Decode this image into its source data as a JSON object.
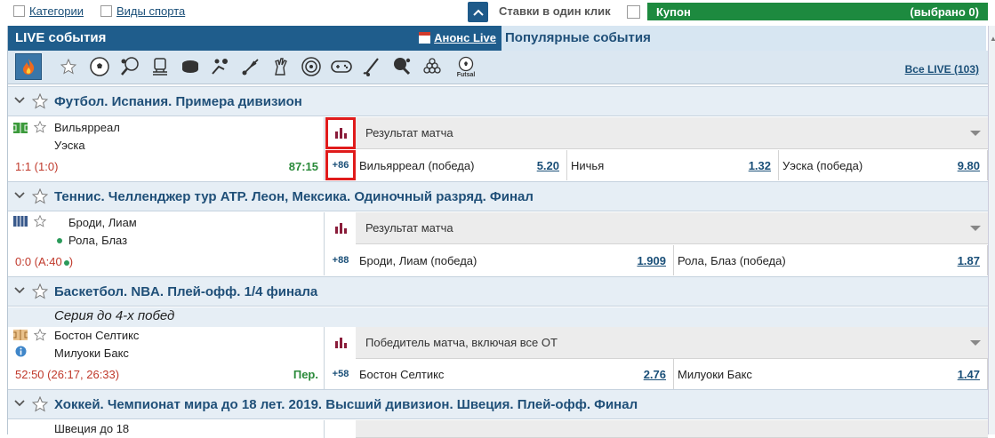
{
  "topbar": {
    "filters": [
      {
        "label": "Категории"
      },
      {
        "label": "Виды спорта"
      }
    ],
    "one_click_label": "Ставки в один клик",
    "coupon_label": "Купон",
    "coupon_selected": "(выбрано 0)"
  },
  "live": {
    "title": "LIVE события",
    "anons_label": "Анонс Live",
    "popular_title": "Популярные события",
    "all_live_label": "Все LIVE (103)",
    "sport_icons": [
      "fire-icon",
      "star-icon",
      "football-icon",
      "tennis-icon",
      "ice-skating-icon",
      "hockey-puck-icon",
      "volleyball-icon",
      "badminton-icon",
      "handball-icon",
      "darts-icon",
      "esports-gamepad-icon",
      "field-hockey-icon",
      "table-tennis-icon",
      "snooker-icon",
      "futsal-icon"
    ],
    "futsal_label": "Futsal"
  },
  "events": [
    {
      "league": "Футбол. Испания. Примера дивизион",
      "team1": "Вильярреал",
      "team2": "Уэска",
      "score": "1:1 (1:0)",
      "time": "87:15",
      "more": "+86",
      "market": "Результат матча",
      "odds": [
        {
          "label": "Вильярреал (победа)",
          "value": "5.20"
        },
        {
          "label": "Ничья",
          "value": "1.32"
        },
        {
          "label": "Уэска (победа)",
          "value": "9.80"
        }
      ]
    },
    {
      "league": "Теннис. Челленджер тур ATP. Леон, Мексика. Одиночный разряд. Финал",
      "team1": "Броди, Лиам",
      "team2": "Рола, Блаз",
      "score": "0:0 (A:40",
      "more": "+88",
      "market": "Результат матча",
      "odds": [
        {
          "label": "Броди, Лиам (победа)",
          "value": "1.909"
        },
        {
          "label": "Рола, Блаз (победа)",
          "value": "1.87"
        }
      ]
    },
    {
      "league": "Баскетбол. NBA. Плей-офф. 1/4 финала",
      "series": "Серия до 4-х побед",
      "team1": "Бостон Селтикс",
      "team2": "Милуоки Бакс",
      "score": "52:50 (26:17, 26:33)",
      "time": "Пер.",
      "more": "+58",
      "market": "Победитель матча, включая все ОТ",
      "odds": [
        {
          "label": "Бостон Селтикс",
          "value": "2.76"
        },
        {
          "label": "Милуоки Бакс",
          "value": "1.47"
        }
      ]
    },
    {
      "league": "Хоккей. Чемпионат мира до 18 лет. 2019. Высший дивизион. Швеция. Плей-офф. Финал",
      "team1": "Швеция до 18"
    }
  ],
  "colors": {
    "header_blue": "#1f5d8c",
    "coupon_green": "#1d8a3f",
    "score_red": "#c0392b",
    "time_green": "#2a8a3a",
    "highlight_red": "#e01b1b"
  }
}
